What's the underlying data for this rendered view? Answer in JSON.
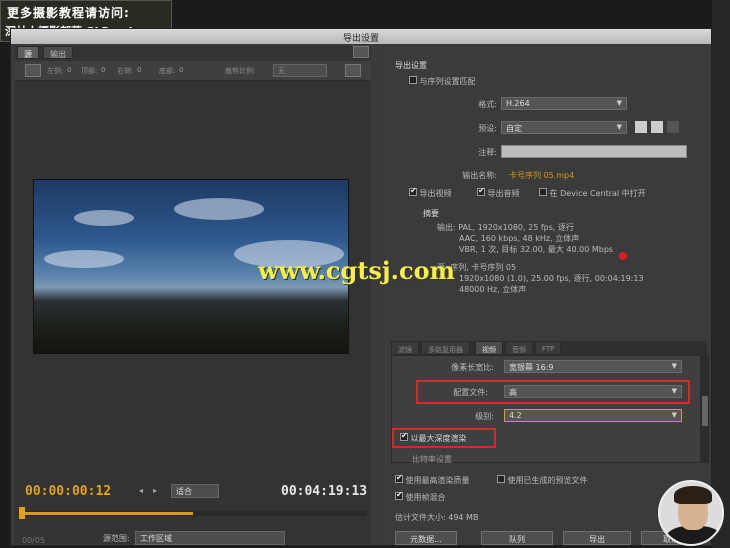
{
  "watermark": {
    "line1": "更多摄影教程请访问:",
    "line2_cn": "深林人摄影部落",
    "line2_en": "SLReady.com"
  },
  "dialog": {
    "title": "导出设置"
  },
  "left_pane": {
    "tabs": [
      "源",
      "输出"
    ],
    "toolbar": {
      "labels": [
        "左侧:",
        "顶部:",
        "右侧:",
        "底部:"
      ],
      "values": [
        "0",
        "0",
        "0",
        "0"
      ],
      "aspect_label": "裁剪比例:",
      "aspect_value": "无"
    },
    "timecode_current": "00:00:00:12",
    "timecode_duration": "00:04:19:13",
    "fit_select": "适合",
    "range_label": "源范围:",
    "range_value": "工作区域"
  },
  "right_pane": {
    "section_export": "导出设置",
    "match_sequence": "与序列设置匹配",
    "format_label": "格式:",
    "format_value": "H.264",
    "preset_label": "预设:",
    "preset_value": "自定",
    "comment_label": "注释:",
    "output_name_label": "输出名称:",
    "output_name_value": "卡号序列 05.mp4",
    "export_video": "导出视频",
    "export_audio": "导出音频",
    "open_in_device": "在 Device Central 中打开",
    "summary_title": "摘要",
    "summary_output": [
      "输出: PAL, 1920x1080, 25 fps, 逐行",
      "AAC, 160 kbps, 48 kHz, 立体声",
      "VBR, 1 次, 目标 32.00, 最大 40.00 Mbps"
    ],
    "summary_source": [
      "源: 序列, 卡号序列 05",
      "1920x1080 (1.0), 25.00 fps, 逐行, 00:04:19:13",
      "48000 Hz, 立体声"
    ],
    "tabs2": [
      "滤镜",
      "多路复用器",
      "视频",
      "音频",
      "FTP"
    ],
    "pixel_aspect_label": "像素长宽比:",
    "pixel_aspect_value": "宽银幕 16:9",
    "profile_label": "配置文件:",
    "profile_value": "高",
    "level_label": "级别:",
    "level_value": "4.2",
    "max_depth": "以最大深度渲染",
    "section_encode": "比特率设置",
    "max_quality": "使用最高渲染质量",
    "use_previews": "使用已生成的预览文件",
    "frame_blend": "使用帧混合",
    "file_size": "估计文件大小: 494 MB",
    "buttons": [
      "元数据...",
      "队列",
      "导出",
      "取消"
    ]
  },
  "overlay": {
    "url": "www.cgtsj.com"
  },
  "footer": {
    "page": "00/05"
  }
}
